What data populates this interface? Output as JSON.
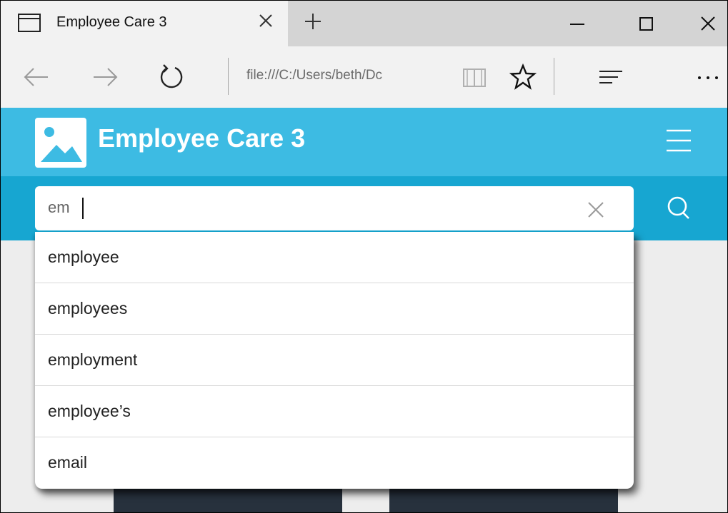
{
  "browser": {
    "tab_title": "Employee Care 3",
    "url": "file:///C:/Users/beth/Dc"
  },
  "app": {
    "title": "Employee Care 3",
    "header_color": "#3dbbe3",
    "search_bar_color": "#17a6d1"
  },
  "search": {
    "value": "em"
  },
  "suggestions": [
    "employee",
    "employees",
    "employment",
    "employee’s",
    "email"
  ],
  "icons": {
    "tab": "page-icon",
    "close": "close-icon",
    "new_tab": "plus-icon",
    "back": "back-arrow-icon",
    "forward": "forward-arrow-icon",
    "refresh": "refresh-icon",
    "reading_view": "book-icon",
    "favorite": "star-icon",
    "hub": "hub-icon",
    "more": "more-icon",
    "logo": "image-icon",
    "menu": "hamburger-icon",
    "search": "search-icon"
  }
}
